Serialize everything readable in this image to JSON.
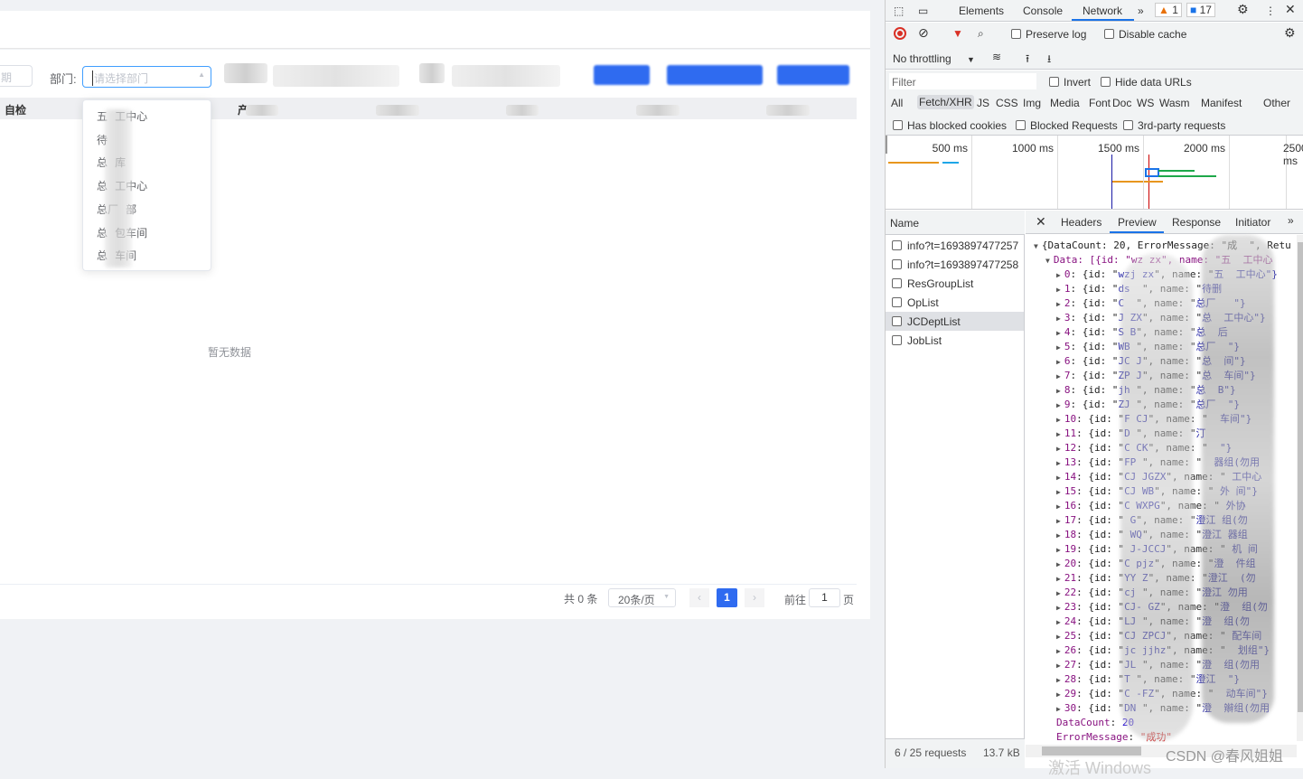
{
  "page": {
    "date_placeholder_fragment": "期",
    "dept_label": "部门:",
    "dept_placeholder": "请选择部门",
    "dept_options": [
      "五   工中心",
      "待",
      "总   库",
      "总   工中心",
      "总厂   部",
      "总   包车间",
      "总   车间"
    ],
    "table_headers": [
      "自检",
      "产"
    ],
    "empty_text": "暂无数据",
    "pagination": {
      "total": "共 0 条",
      "page_size": "20条/页",
      "current_page": "1",
      "goto_label": "前往",
      "goto_value": "1",
      "page_suffix": "页"
    },
    "accent": "#409eff"
  },
  "devtools": {
    "tabs": [
      "Elements",
      "Console",
      "Network"
    ],
    "active_tab": "Network",
    "warnings": "1",
    "messages": "17",
    "preserve_log": "Preserve log",
    "disable_cache": "Disable cache",
    "throttling": "No throttling",
    "filter_placeholder": "Filter",
    "invert": "Invert",
    "hide_data_urls": "Hide data URLs",
    "type_filters": [
      "All",
      "Fetch/XHR",
      "JS",
      "CSS",
      "Img",
      "Media",
      "Font",
      "Doc",
      "WS",
      "Wasm",
      "Manifest",
      "Other"
    ],
    "active_type": "Fetch/XHR",
    "blocked_cookies": "Has blocked cookies",
    "blocked_requests": "Blocked Requests",
    "third_party": "3rd-party requests",
    "timeline_ticks": [
      "500 ms",
      "1000 ms",
      "1500 ms",
      "2000 ms",
      "2500 ms"
    ],
    "name_header": "Name",
    "requests": [
      "info?t=1693897477257",
      "info?t=1693897477258",
      "ResGroupList",
      "OpList",
      "JCDeptList",
      "JobList"
    ],
    "selected_request": "JCDeptList",
    "detail_tabs": [
      "Headers",
      "Preview",
      "Response",
      "Initiator"
    ],
    "active_detail_tab": "Preview",
    "status_requests": "6 / 25 requests",
    "status_size": "13.7 kB",
    "preview": {
      "root": "{DataCount: 20, ErrorMessage: \"成  \", Retu",
      "data_line": "Data: [{id: \"wz zx\", name: \"五  工中心",
      "rows": [
        [
          "0",
          "wzj zx",
          "五  工中心\"}"
        ],
        [
          "1",
          "ds  ",
          "待删"
        ],
        [
          "2",
          "C  ",
          "总厂   \"}"
        ],
        [
          "3",
          "J ZX",
          "总  工中心\"}"
        ],
        [
          "4",
          "S B",
          "总  后"
        ],
        [
          "5",
          "WB ",
          "总厂  \"}"
        ],
        [
          "6",
          "JC J",
          "总  间\"}"
        ],
        [
          "7",
          "ZP J",
          "总  车间\"}"
        ],
        [
          "8",
          "jh ",
          "总  B\"}"
        ],
        [
          "9",
          "ZJ ",
          "总厂  \"}"
        ],
        [
          "10",
          "F CJ",
          "  车间\"}"
        ],
        [
          "11",
          "D ",
          "汀"
        ],
        [
          "12",
          "C CK",
          "  \"}"
        ],
        [
          "13",
          "FP ",
          "  器组(勿用"
        ],
        [
          "14",
          "CJ JGZX",
          " 工中心"
        ],
        [
          "15",
          "CJ WB",
          " 外 间\"}"
        ],
        [
          "16",
          "C WXPG",
          " 外协 "
        ],
        [
          "17",
          " G",
          "澄江 组(勿"
        ],
        [
          "18",
          " WQ",
          "澄江 器组"
        ],
        [
          "19",
          " J-JCCJ",
          " 机 间"
        ],
        [
          "20",
          "C pjz",
          "澄  件组"
        ],
        [
          "21",
          "YY Z",
          "澄江  (勿"
        ],
        [
          "22",
          "cj ",
          "澄江 勿用"
        ],
        [
          "23",
          "CJ- GZ",
          "澄  组(勿"
        ],
        [
          "24",
          "LJ ",
          "澄  组(勿"
        ],
        [
          "25",
          "CJ ZPCJ",
          " 配车间"
        ],
        [
          "26",
          "jc jjhz",
          "  划组\"}"
        ],
        [
          "27",
          "JL ",
          "澄  组(勿用"
        ],
        [
          "28",
          "T ",
          "澄江  \"}"
        ],
        [
          "29",
          "C -FZ",
          "  动车间\"}"
        ],
        [
          "30",
          "DN ",
          "澄  辮组(勿用"
        ]
      ],
      "data_count_key": "DataCount",
      "data_count_value": "20",
      "error_key": "ErrorMessage",
      "error_value": "\"成功\""
    },
    "watermark": "CSDN @春风姐姐",
    "windows_watermark": "激活 Windows"
  }
}
